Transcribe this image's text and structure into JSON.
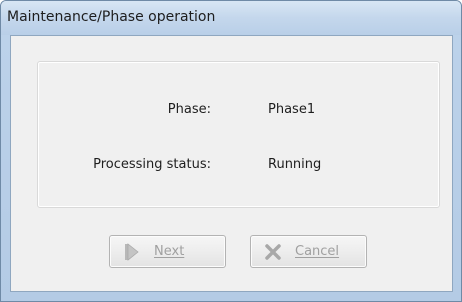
{
  "window": {
    "title": "Maintenance/Phase operation"
  },
  "info": {
    "phase_label": "Phase:",
    "phase_value": "Phase1",
    "status_label": "Processing status:",
    "status_value": "Running"
  },
  "buttons": {
    "next_label": "Next",
    "cancel_label": "Cancel",
    "next_icon": "play-arrow-icon",
    "cancel_icon": "close-x-icon",
    "enabled": false
  },
  "colors": {
    "disabled_text": "#a0a0a0",
    "titlebar": "#c4d7ec"
  }
}
